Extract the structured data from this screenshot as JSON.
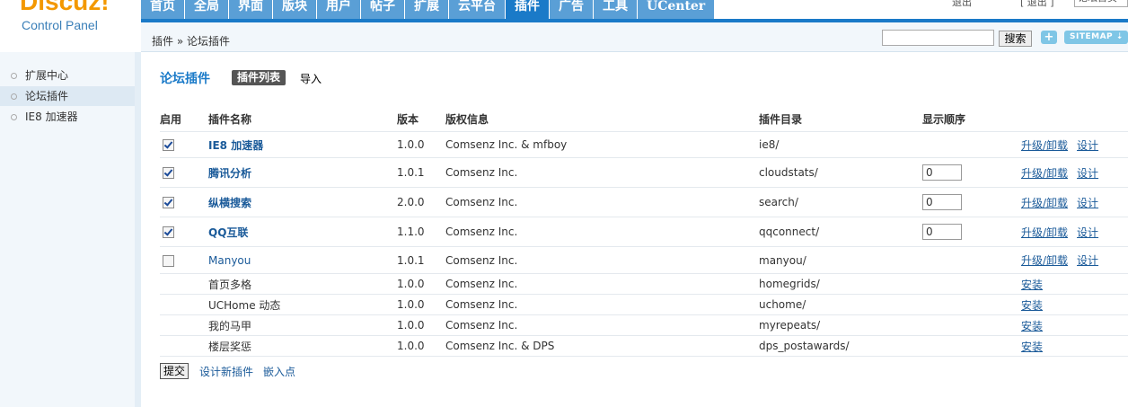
{
  "brand": {
    "logo": "Discuz!",
    "subtitle": "Control Panel"
  },
  "nav": [
    {
      "label": "首页",
      "active": false
    },
    {
      "label": "全局",
      "active": false
    },
    {
      "label": "界面",
      "active": false
    },
    {
      "label": "版块",
      "active": false
    },
    {
      "label": "用户",
      "active": false
    },
    {
      "label": "帖子",
      "active": false
    },
    {
      "label": "扩展",
      "active": false
    },
    {
      "label": "云平台",
      "active": false
    },
    {
      "label": "插件",
      "active": true
    },
    {
      "label": "广告",
      "active": false
    },
    {
      "label": "工具",
      "active": false
    },
    {
      "label": "UCenter",
      "active": false
    }
  ],
  "top_right": {
    "text_a": "退出",
    "text_b": "[ 退出 ]",
    "input_value": "论坛首页"
  },
  "breadcrumb": "插件 » 论坛插件",
  "crumb_search": {
    "value": "",
    "button": "搜索",
    "plus": "+",
    "sitemap": "SITEMAP ⇣"
  },
  "sidebar": [
    {
      "label": "扩展中心",
      "active": false
    },
    {
      "label": "论坛插件",
      "active": true
    },
    {
      "label": "IE8 加速器",
      "active": false
    }
  ],
  "main": {
    "title": "论坛插件",
    "tab_list": "插件列表",
    "tab_import": "导入",
    "headers": [
      "启用",
      "插件名称",
      "版本",
      "版权信息",
      "插件目录",
      "显示顺序",
      ""
    ],
    "rows": [
      {
        "enabled": true,
        "name": "IE8 加速器",
        "bold": true,
        "version": "1.0.0",
        "copyright": "Comsenz Inc. & mfboy",
        "dir": "ie8/",
        "order": null,
        "actions": [
          "升级/卸载",
          "设计"
        ]
      },
      {
        "enabled": true,
        "name": "腾讯分析",
        "bold": true,
        "version": "1.0.1",
        "copyright": "Comsenz Inc.",
        "dir": "cloudstats/",
        "order": "0",
        "actions": [
          "升级/卸载",
          "设计"
        ]
      },
      {
        "enabled": true,
        "name": "纵横搜索",
        "bold": true,
        "version": "2.0.0",
        "copyright": "Comsenz Inc.",
        "dir": "search/",
        "order": "0",
        "actions": [
          "升级/卸载",
          "设计"
        ]
      },
      {
        "enabled": true,
        "name": "QQ互联",
        "bold": true,
        "version": "1.1.0",
        "copyright": "Comsenz Inc.",
        "dir": "qqconnect/",
        "order": "0",
        "actions": [
          "升级/卸载",
          "设计"
        ]
      },
      {
        "enabled": false,
        "name": "Manyou",
        "bold": false,
        "link": true,
        "version": "1.0.1",
        "copyright": "Comsenz Inc.",
        "dir": "manyou/",
        "order": null,
        "actions": [
          "升级/卸载",
          "设计"
        ]
      },
      {
        "enabled": null,
        "name": "首页多格",
        "bold": false,
        "version": "1.0.0",
        "copyright": "Comsenz Inc.",
        "dir": "homegrids/",
        "order": null,
        "actions": [
          "安装"
        ]
      },
      {
        "enabled": null,
        "name": "UCHome 动态",
        "bold": false,
        "version": "1.0.0",
        "copyright": "Comsenz Inc.",
        "dir": "uchome/",
        "order": null,
        "actions": [
          "安装"
        ]
      },
      {
        "enabled": null,
        "name": "我的马甲",
        "bold": false,
        "version": "1.0.0",
        "copyright": "Comsenz Inc.",
        "dir": "myrepeats/",
        "order": null,
        "actions": [
          "安装"
        ]
      },
      {
        "enabled": null,
        "name": "楼层奖惩",
        "bold": false,
        "version": "1.0.0",
        "copyright": "Comsenz Inc. & DPS",
        "dir": "dps_postawards/",
        "order": null,
        "actions": [
          "安装"
        ]
      }
    ],
    "submit": "提交",
    "link_design": "设计新插件",
    "link_hooks": "嵌入点"
  },
  "colors": {
    "accent": "#1a7ac8",
    "logo": "#f39800",
    "link": "#1a5a99"
  }
}
